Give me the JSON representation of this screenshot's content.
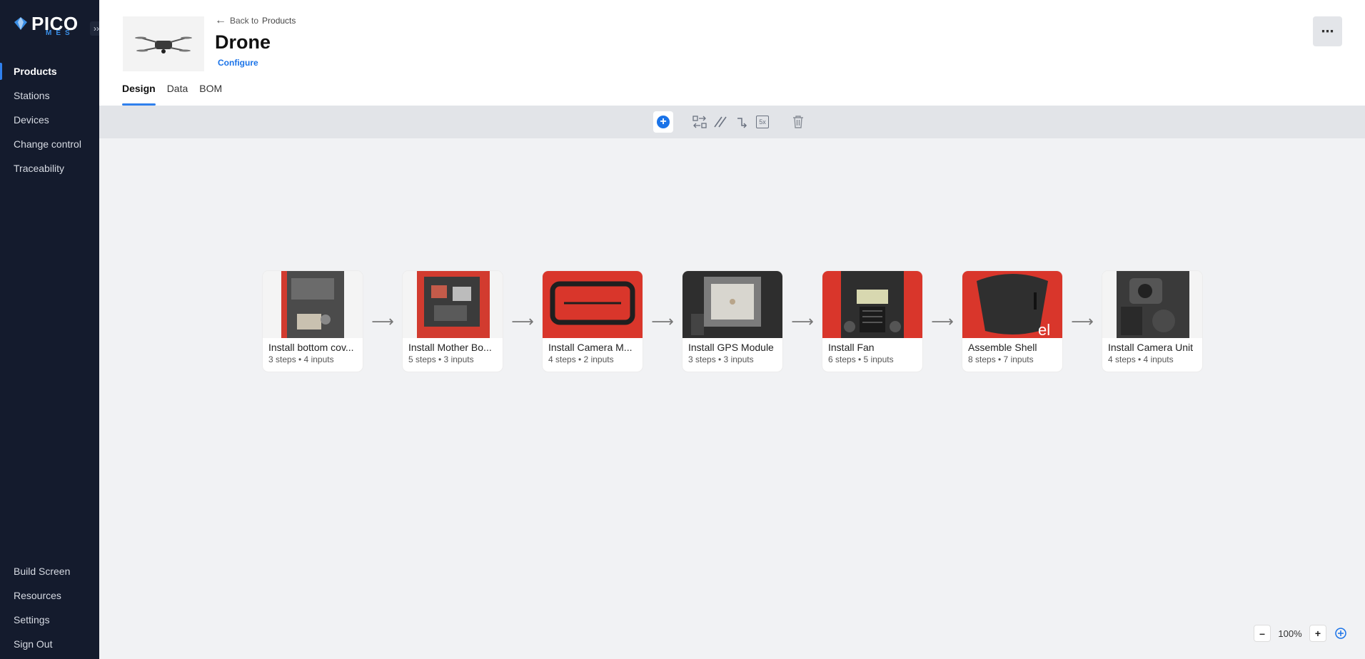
{
  "app": {
    "logo_text": "PICO",
    "logo_sub": "MES",
    "accent_color": "#1a73e8"
  },
  "sidebar": {
    "items": [
      {
        "label": "Products",
        "active": true
      },
      {
        "label": "Stations"
      },
      {
        "label": "Devices"
      },
      {
        "label": "Change control"
      },
      {
        "label": "Traceability"
      }
    ],
    "bottom_items": [
      {
        "label": "Build Screen"
      },
      {
        "label": "Resources"
      },
      {
        "label": "Settings"
      },
      {
        "label": "Sign Out"
      }
    ]
  },
  "header": {
    "back_prefix": "Back to",
    "back_target": "Products",
    "title": "Drone",
    "configure_label": "Configure",
    "more_icon": "ellipsis-icon",
    "tabs": [
      {
        "label": "Design",
        "active": true
      },
      {
        "label": "Data"
      },
      {
        "label": "BOM"
      }
    ]
  },
  "toolbar": {
    "tools": [
      "add-icon",
      "swap-icon",
      "parallel-icon",
      "connector-icon",
      "repeat-icon",
      "trash-icon"
    ],
    "repeat_label": "5x"
  },
  "flow": {
    "stations": [
      {
        "title": "Install bottom cov...",
        "meta": "3 steps • 4 inputs"
      },
      {
        "title": "Install Mother Bo...",
        "meta": "5 steps • 3 inputs"
      },
      {
        "title": "Install Camera M...",
        "meta": "4 steps • 2 inputs"
      },
      {
        "title": "Install GPS Module",
        "meta": "3 steps • 3 inputs"
      },
      {
        "title": "Install Fan",
        "meta": "6 steps • 5 inputs"
      },
      {
        "title": "Assemble Shell",
        "meta": "8 steps • 7 inputs"
      },
      {
        "title": "Install Camera Unit",
        "meta": "4 steps • 4 inputs"
      }
    ]
  },
  "zoom": {
    "minus": "–",
    "level": "100%",
    "plus": "+"
  }
}
